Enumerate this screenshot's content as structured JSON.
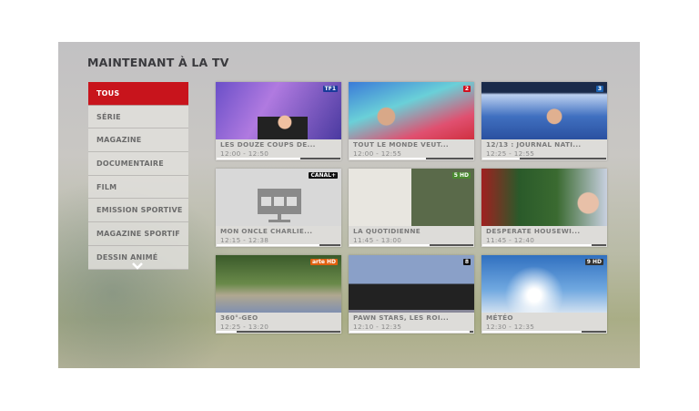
{
  "title": "MAINTENANT À LA TV",
  "categories": [
    {
      "label": "TOUS",
      "active": true
    },
    {
      "label": "SÉRIE"
    },
    {
      "label": "MAGAZINE"
    },
    {
      "label": "DOCUMENTAIRE"
    },
    {
      "label": "FILM"
    },
    {
      "label": "EMISSION SPORTIVE"
    },
    {
      "label": "MAGAZINE SPORTIF"
    },
    {
      "label": "DESSIN ANIMÉ"
    }
  ],
  "more_icon": "chevron-down-icon",
  "programs": [
    {
      "title": "LES DOUZE COUPS DE...",
      "time": "12:00 - 12:50",
      "channel": "TF1",
      "progress": 0.68
    },
    {
      "title": "TOUT LE MONDE VEUT...",
      "time": "12:00 - 12:55",
      "channel": "2",
      "progress": 0.62
    },
    {
      "title": "12/13 : JOURNAL NATI...",
      "time": "12:25 - 12:55",
      "channel": "3",
      "progress": 0.3
    },
    {
      "title": "MON ONCLE CHARLIE...",
      "time": "12:15 - 12:38",
      "channel": "CANAL+",
      "progress": 0.83
    },
    {
      "title": "LA QUOTIDIENNE",
      "time": "11:45 - 13:00",
      "channel": "5 HD",
      "progress": 0.65
    },
    {
      "title": "DESPERATE HOUSEWI...",
      "time": "11:45 - 12:40",
      "channel": "",
      "progress": 0.88
    },
    {
      "title": "360°-GEO",
      "time": "12:25 - 13:20",
      "channel": "arte HD",
      "progress": 0.16
    },
    {
      "title": "PAWN STARS, LES ROI...",
      "time": "12:10 - 12:35",
      "channel": "8",
      "progress": 0.97
    },
    {
      "title": "MÉTÉO",
      "time": "12:30 - 12:35",
      "channel": "9 HD",
      "progress": 0.8
    }
  ]
}
